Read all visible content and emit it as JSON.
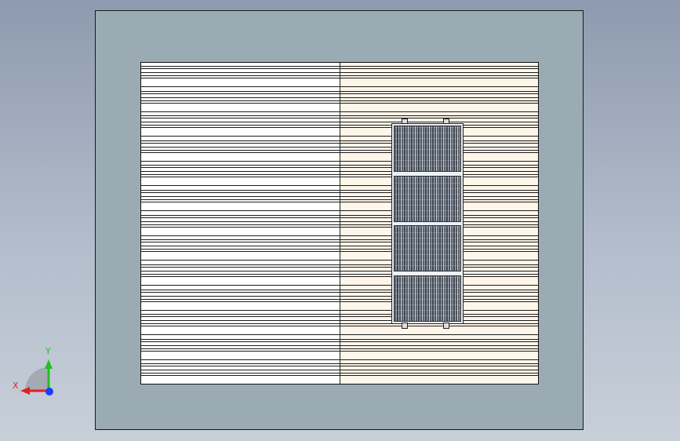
{
  "viewport": {
    "name": "cad-viewport",
    "background_top": "#8e9aaf",
    "background_bottom": "#c8cfd9"
  },
  "model": {
    "base_plate_color": "#9aabb3",
    "floor_left_color": "#ffffff",
    "floor_right_color": "#fff6ea",
    "slat_groups": 13,
    "rack_panels": 4,
    "panel_color": "#5b6470"
  },
  "triad": {
    "x_label": "X",
    "y_label": "Y",
    "x_color": "#e02020",
    "y_color": "#20c020",
    "z_color": "#1a3cff"
  }
}
